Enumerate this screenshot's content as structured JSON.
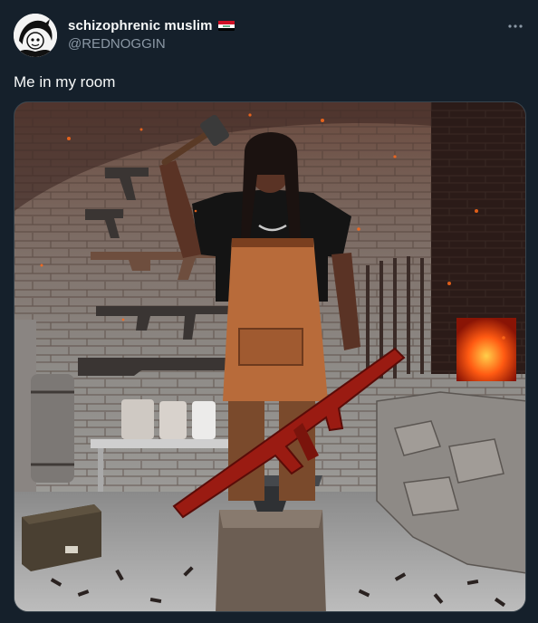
{
  "tweet": {
    "author": {
      "display_name": "schizophrenic muslim",
      "handle": "@REDNOGGIN",
      "flag": "iraq-flag"
    },
    "text": "Me in my room",
    "media": {
      "description_icon": "photo"
    }
  },
  "colors": {
    "background": "#15202b",
    "text_primary": "#f7f9f9",
    "text_secondary": "#8b98a5",
    "border": "#38444d"
  }
}
